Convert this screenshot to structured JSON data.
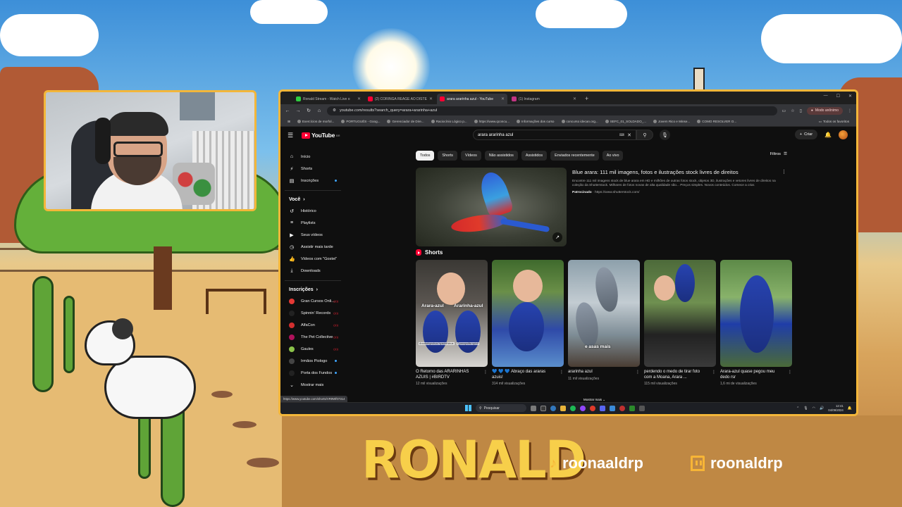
{
  "browser": {
    "tabs": [
      {
        "title": "Ronald Stream - Watch Live o",
        "color": "#2ecc40",
        "active": false
      },
      {
        "title": "(2) CORINGA REAGE AO DISTE",
        "color": "#ff0033",
        "active": false
      },
      {
        "title": "arara ararinha azul - YouTube",
        "color": "#ff0033",
        "active": true
      },
      {
        "title": "(1) Instagram",
        "color": "#c13584",
        "active": false
      }
    ],
    "url": "youtube.com/results?search_query=arara+ararinha+azul",
    "profile": "Modo anônimo",
    "bookmarks": [
      "Exercícios de morfol...",
      "PORTUGUÊS - Goog...",
      "Gerenciador de Dire...",
      "Raciocínio Lógico p...",
      "https://www.qconcu...",
      "Informações dos curso",
      "concurso idecan.org...",
      "SEFC_01_SOLDADO_...",
      "Jovem Rico e Minse...",
      "COMO RESOLVER O..."
    ],
    "bookmarks_right": "Todos os favoritos",
    "status_url": "https://www.youtube.com/shorts/VR9Wf07314"
  },
  "youtube": {
    "logo": "YouTube",
    "country": "BR",
    "search_query": "arara ararinha azul",
    "create_label": "Criar",
    "sidebar": {
      "main": [
        {
          "label": "Início",
          "icon": "home-icon",
          "glyph": "⌂"
        },
        {
          "label": "Shorts",
          "icon": "shorts-icon",
          "glyph": "⚡"
        },
        {
          "label": "Inscrições",
          "icon": "subscriptions-icon",
          "glyph": "▤"
        }
      ],
      "you_header": "Você",
      "you": [
        {
          "label": "Histórico",
          "icon": "history-icon",
          "glyph": "↺"
        },
        {
          "label": "Playlists",
          "icon": "playlists-icon",
          "glyph": "≡"
        },
        {
          "label": "Seus vídeos",
          "icon": "your-videos-icon",
          "glyph": "▶"
        },
        {
          "label": "Assistir mais tarde",
          "icon": "watch-later-icon",
          "glyph": "◷"
        },
        {
          "label": "Vídeos com \"Gostei\"",
          "icon": "liked-icon",
          "glyph": "👍"
        },
        {
          "label": "Downloads",
          "icon": "downloads-icon",
          "glyph": "⤓"
        }
      ],
      "subs_header": "Inscrições",
      "subscriptions": [
        {
          "label": "Gran Cursos Onli...",
          "color": "#e53935",
          "badge": "live"
        },
        {
          "label": "Spinnin' Records",
          "color": "#222222",
          "badge": "live"
        },
        {
          "label": "AlfaCon",
          "color": "#d32f2f",
          "badge": "live"
        },
        {
          "label": "The Pet Collective",
          "color": "#b0125b",
          "badge": "live"
        },
        {
          "label": "Gaules",
          "color": "#8bc34a",
          "badge": "live"
        },
        {
          "label": "Irmãos Piologo",
          "color": "#444444",
          "badge": "dot"
        },
        {
          "label": "Porta dos Fundos",
          "color": "#222222",
          "badge": "dot"
        }
      ],
      "show_more": "Mostrar mais"
    },
    "chips": [
      "Todos",
      "Shorts",
      "Vídeos",
      "Não assistidos",
      "Assistidos",
      "Enviados recentemente",
      "Ao vivo"
    ],
    "filters_label": "Filtros",
    "ad": {
      "title": "Blue arara: 111 mil imagens, fotos e ilustrações stock livres de direitos",
      "description": "Encontre 111 mil imagens stock de blue arara em HD e milhões de outras fotos stock, objetos 3D, ilustrações e vetores livres de direitos na coleção da Shutterstock. Milhares de fotos novas de alta qualidade são... Preços simples. Novos conteúdos. Comece a criar.",
      "sponsored": "Patrocinado",
      "domain": "https://www.shutterstock.com/"
    },
    "shorts_header": "Shorts",
    "shorts": [
      {
        "title": "O Retorno das ARARINHAS AZUIS | #BIRDTV",
        "views": "12 mil visualizações",
        "overlay": "Arara-azul"
      },
      {
        "title": "💙 💙 💙 Abraço das araras azuis!",
        "views": "314 mil visualizações",
        "overlay": ""
      },
      {
        "title": "ararinha azul",
        "views": "11 mil visualizações",
        "overlay": "e asas mais"
      },
      {
        "title": "perdendo o medo de tirar foto com a Moana, Arara ...",
        "views": "115 mil visualizações",
        "overlay": ""
      },
      {
        "title": "Arara-azul quase pegou meu dedo rsr",
        "views": "1,6 mi de visualizações",
        "overlay": ""
      }
    ],
    "shorts_overlay_second": "Ararinha-azul",
    "shorts_sub_1": "Anodorhynchus hyacinthinus",
    "shorts_sub_2": "Cyanopsitta spixii",
    "show_more_shorts": "Mostrar mais"
  },
  "taskbar": {
    "search_placeholder": "Pesquisar",
    "time": "12:41",
    "date": "04/09/2024"
  },
  "overlay": {
    "brand": "RONALD",
    "tiktok": "roonaaldrp",
    "twitch": "roonaldrp",
    "accent": "#f3b63a"
  }
}
